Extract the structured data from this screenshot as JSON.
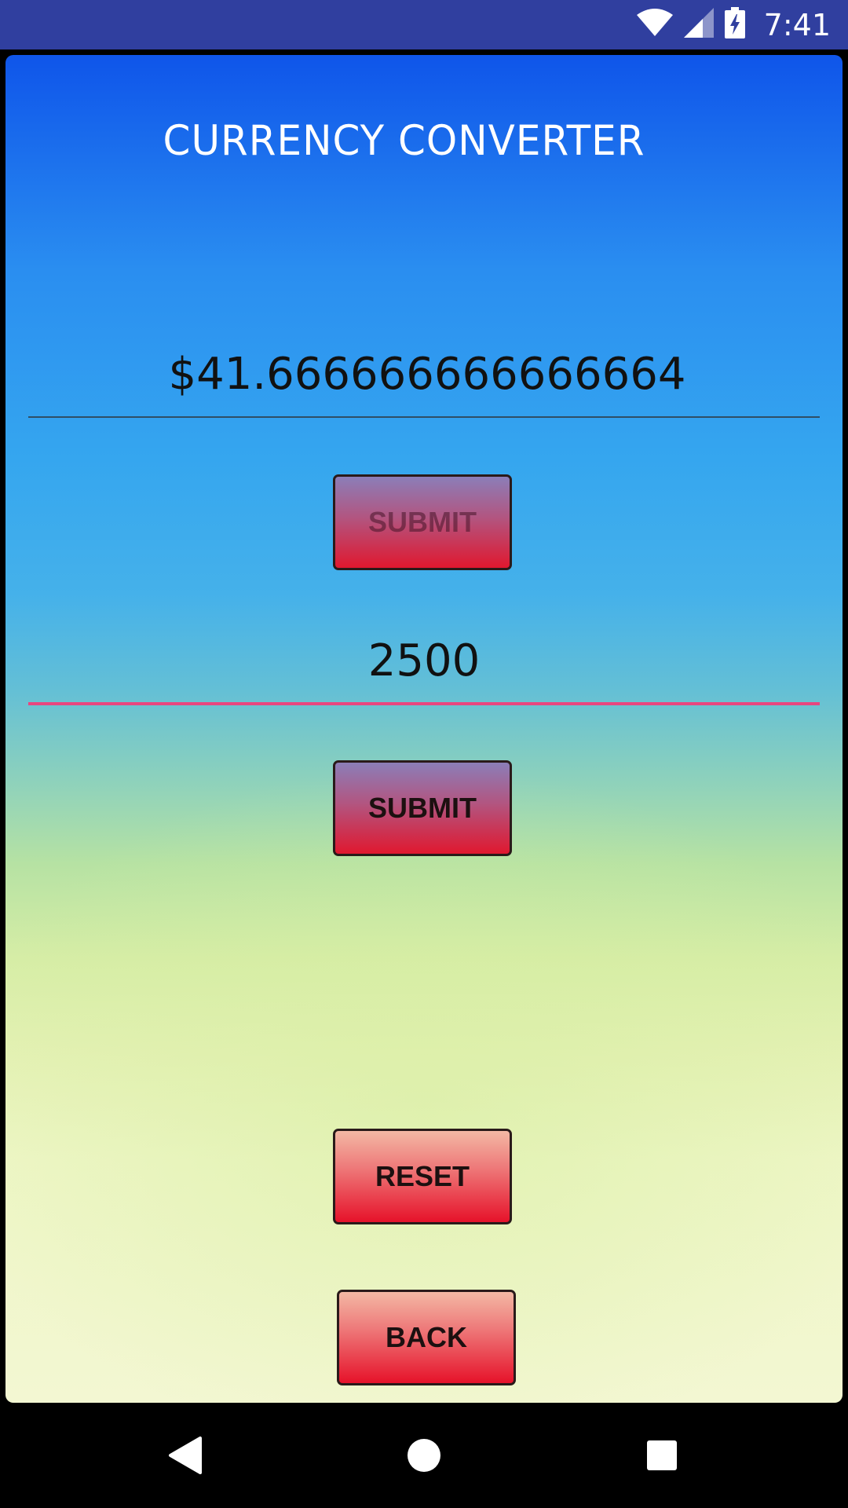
{
  "status_bar": {
    "time": "7:41",
    "icons": [
      "wifi-icon",
      "signal-icon",
      "battery-charging-icon"
    ]
  },
  "app": {
    "title": "CURRENCY CONVERTER"
  },
  "converter": {
    "result_field": {
      "value": "$41.666666666666664"
    },
    "submit_1": {
      "label": "SUBMIT"
    },
    "amount_field": {
      "value": "2500"
    },
    "submit_2": {
      "label": "SUBMIT"
    },
    "reset": {
      "label": "RESET"
    },
    "back": {
      "label": "BACK"
    }
  },
  "colors": {
    "status_bar": "#303f9f",
    "focus_underline": "#e8467f",
    "button_red": "#e6122a"
  },
  "nav_bar": {
    "icons": [
      "back-triangle-icon",
      "home-circle-icon",
      "recents-square-icon"
    ]
  }
}
